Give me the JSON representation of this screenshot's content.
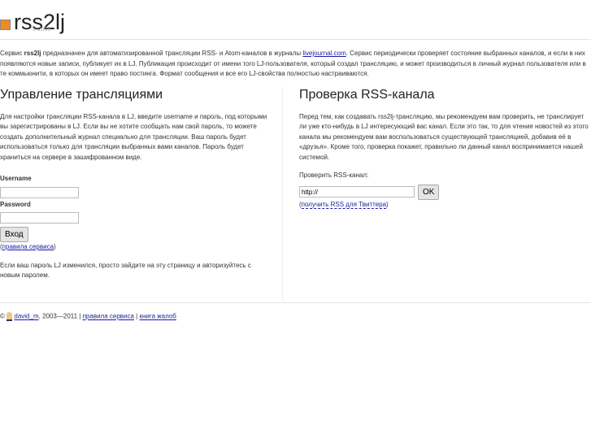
{
  "header": {
    "title": "rss2lj",
    "version": "v. 2009"
  },
  "intro": {
    "before": "Сервис ",
    "brand": "rss2lj",
    "mid": " предназначен для автоматизированной трансляции RSS- и Atom-каналов в журналы ",
    "link": "livejournal.com",
    "after": ". Сервис периодически проверяет состояние выбранных каналов, и если в них появляются новые записи, публикует их в LJ. Публикация происходит от имени того LJ-пользователя, который создал трансляцию, и может производиться в личный журнал пользователя или в те коммьюнити, в которых он имеет право постинга. Формат сообщения и все его LJ-свойства полностью настраиваются."
  },
  "manage": {
    "title": "Управление трансляциями",
    "text": "Для настройки трансляции RSS-канала в LJ, введите username и пароль, под которыми вы зарегистрированы в LJ. Если вы не хотите сообщать нам свой пароль, то можете создать дополнительный журнал специально для трансляции. Ваш пароль будет использоваться только для трансляции выбранных вами каналов. Пароль будет храниться на сервере в зашифрованном виде.",
    "username_label": "Username",
    "password_label": "Password",
    "login_button": "Вход",
    "rules_link": "правила сервиса",
    "note": "Если ваш пароль LJ изменился, просто зайдите на эту страницу и авторизуйтесь с новым паролем."
  },
  "check": {
    "title": "Проверка RSS-канала",
    "text": "Перед тем, как создавать rss2lj-трансляцию, мы рекомендуем вам проверить, не транслирует ли уже кто-нибудь в LJ интересующий вас канал. Если это так, то для чтения новостей из этого канала мы рекомендуем вам воспользоваться существующей трансляцией, добавив её в «друзья». Кроме того, проверка покажет, правильно ли данный канал воспринимается нашей системой.",
    "label": "Проверить RSS-канал:",
    "url_value": "http://",
    "ok_button": "OK",
    "twitter_link": "получить RSS для Твиттера"
  },
  "footer": {
    "copy": "©",
    "user": "david_m",
    "years": ", 2003—2011 | ",
    "rules": "правила сервиса",
    "sep": " | ",
    "complaints": "книга жалоб"
  }
}
